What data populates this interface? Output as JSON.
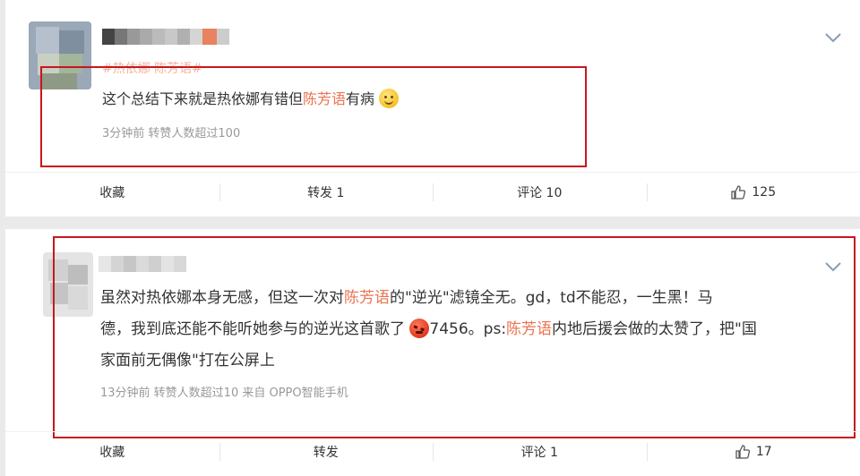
{
  "posts": [
    {
      "topic": "#热依娜 陈芳语#",
      "text_parts": [
        "这个总结下来就是热依娜有错但",
        "陈芳语",
        "有病"
      ],
      "emoji": "smile-emoji",
      "meta": "3分钟前 转赞人数超过100",
      "actions": {
        "favorite": "收藏",
        "repost": "转发 1",
        "comment": "评论 10",
        "like_count": "125"
      }
    },
    {
      "text_parts": [
        "虽然对热依娜本身无感，但这一次对",
        "陈芳语",
        "的\"逆光\"滤镜全无。gd，td不能忍，一生黑！马",
        "德，我到底还能不能听她参与的逆光这首歌了",
        "7456。ps:",
        "陈芳语",
        "内地后援会做的太赞了，把\"国",
        "家面前无偶像\"打在公屏上"
      ],
      "emoji": "angry-emoji",
      "meta": "13分钟前 转赞人数超过10 来自 OPPO智能手机",
      "actions": {
        "favorite": "收藏",
        "repost": "转发",
        "comment": "评论 1",
        "like_count": "17"
      }
    }
  ],
  "colors": {
    "highlight": "#eb7350",
    "annotation_box": "#c8171d",
    "meta": "#999999"
  }
}
